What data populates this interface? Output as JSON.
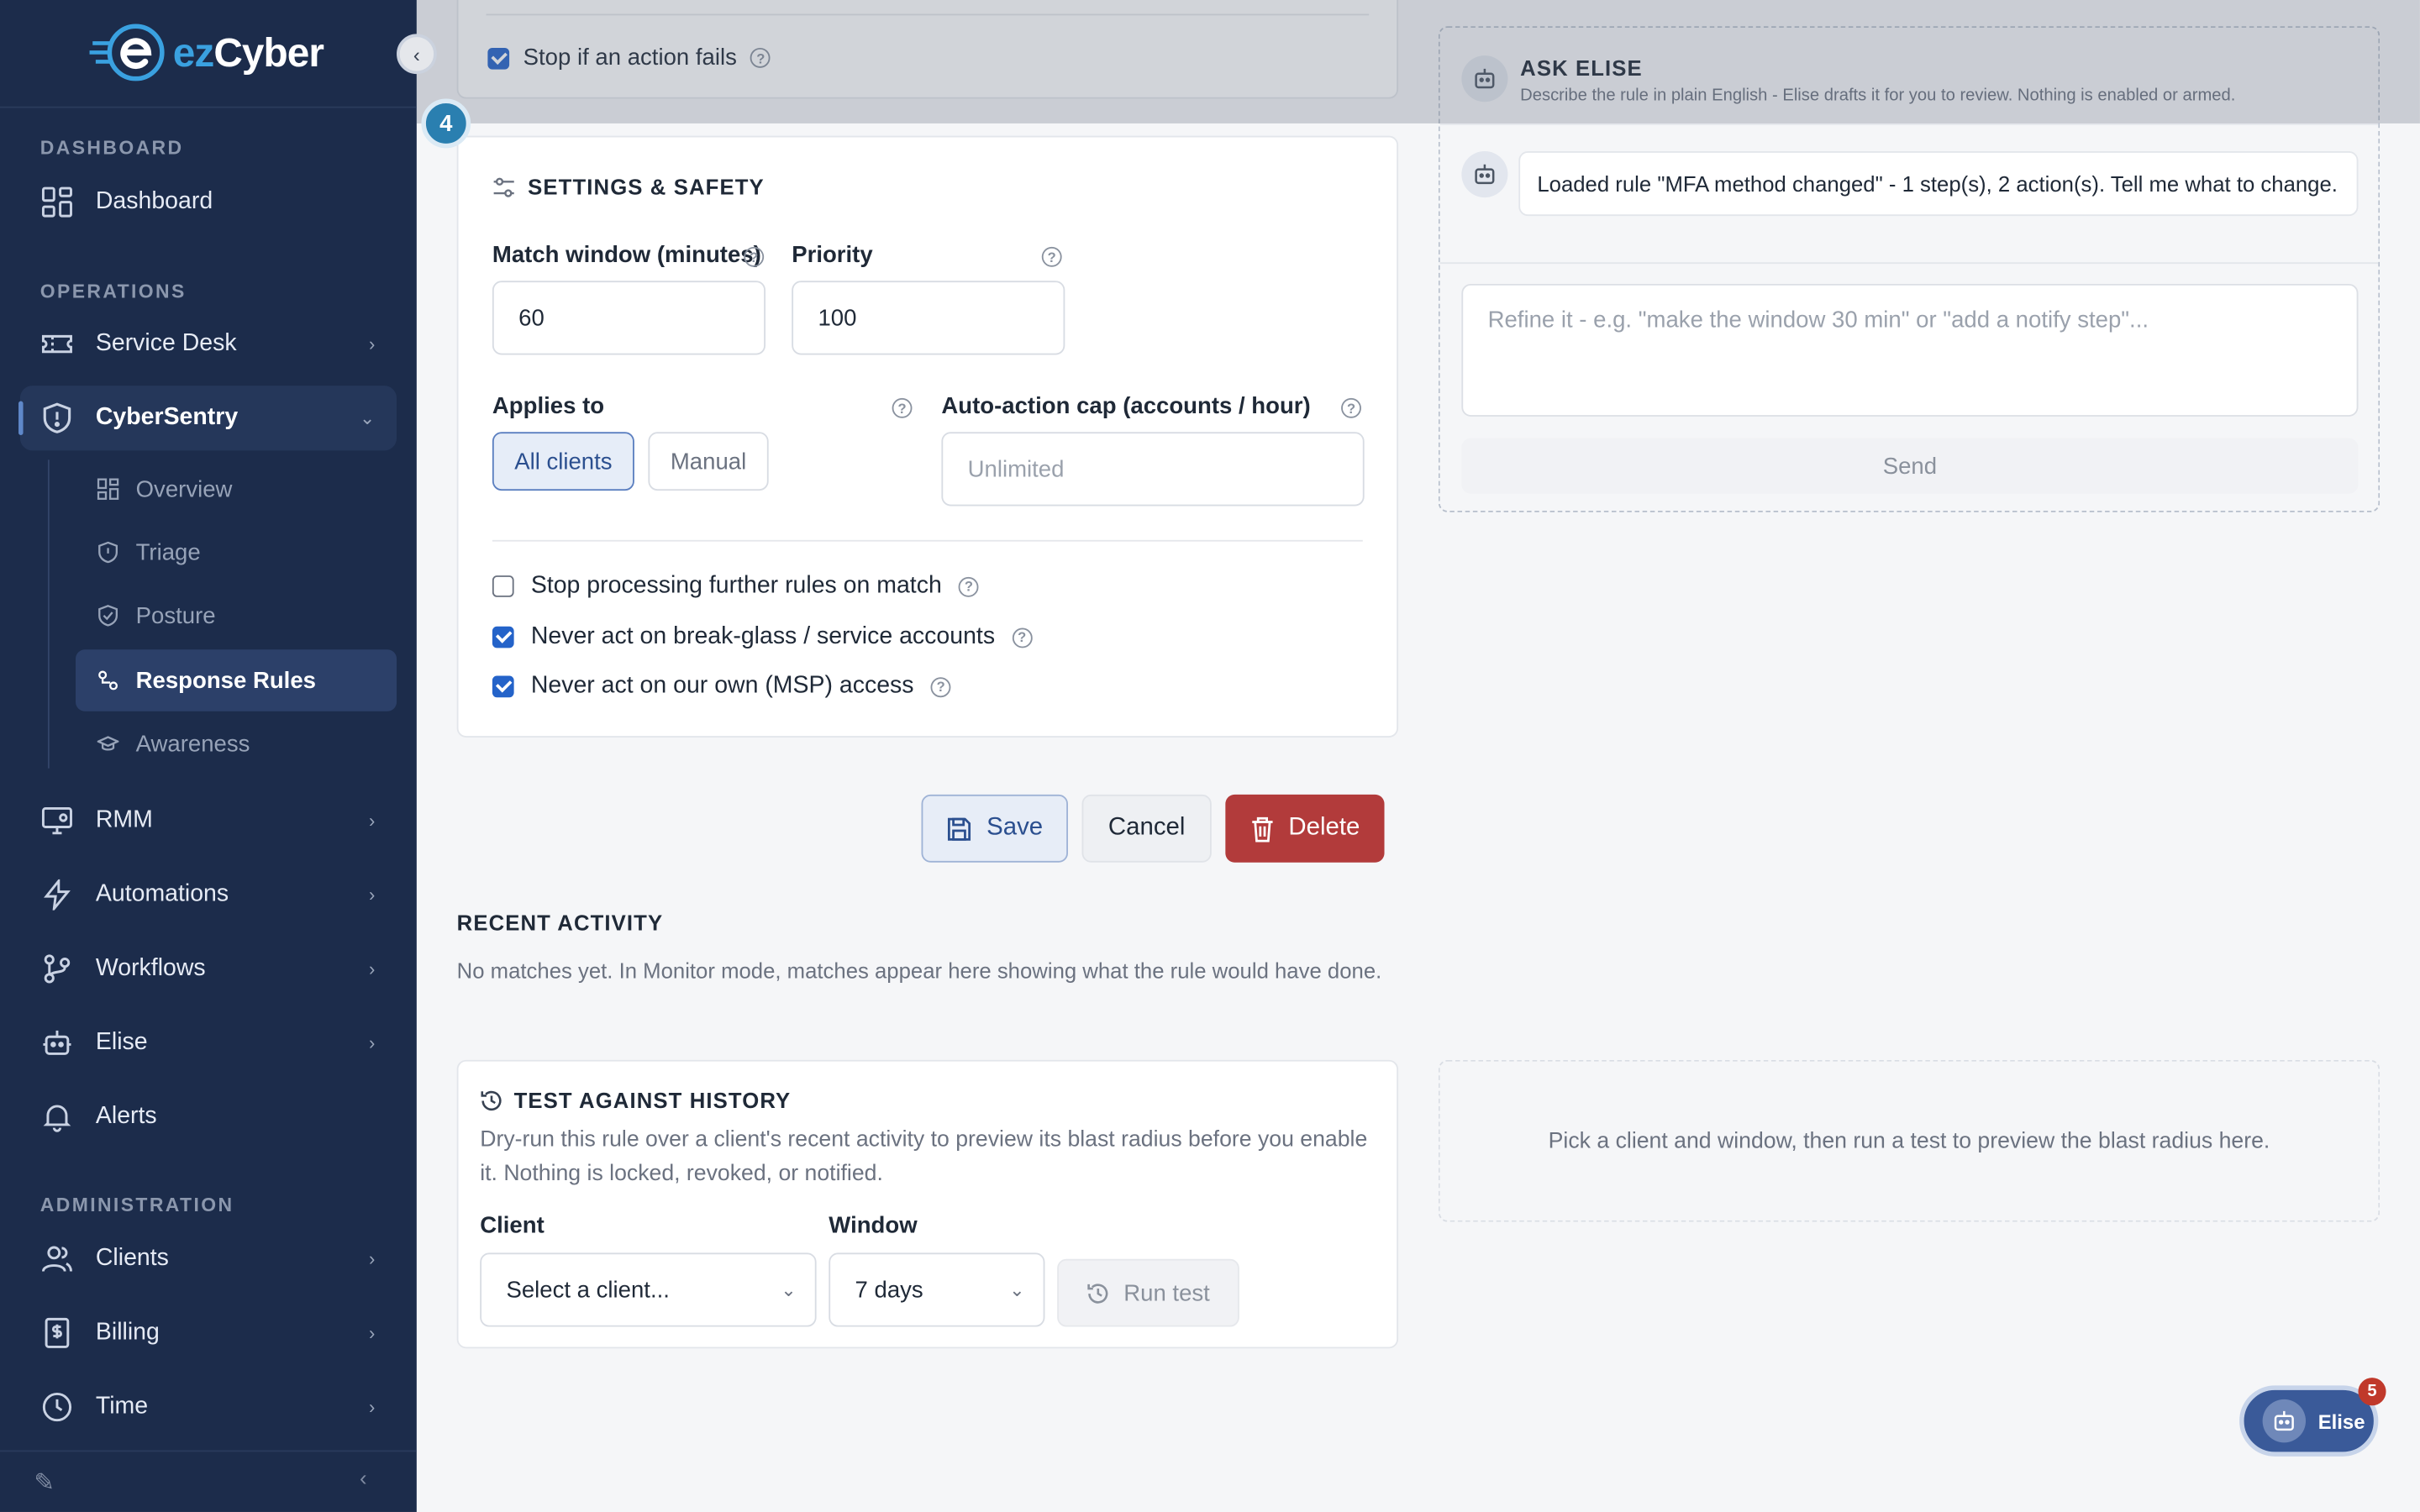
{
  "brand": {
    "logo_prefix": "ez",
    "logo_suffix": "Cyber"
  },
  "sidebar": {
    "sections": {
      "dashboard": "DASHBOARD",
      "operations": "OPERATIONS",
      "administration": "ADMINISTRATION"
    },
    "items": {
      "dashboard": "Dashboard",
      "service_desk": "Service Desk",
      "cybersentry": "CyberSentry",
      "rmm": "RMM",
      "automations": "Automations",
      "workflows": "Workflows",
      "elise": "Elise",
      "alerts": "Alerts",
      "clients": "Clients",
      "billing": "Billing",
      "time": "Time"
    },
    "subitems": {
      "overview": "Overview",
      "triage": "Triage",
      "posture": "Posture",
      "response_rules": "Response Rules",
      "awareness": "Awareness"
    }
  },
  "top_card": {
    "stop_if_fails": "Stop if an action fails",
    "stop_if_fails_checked": true
  },
  "step_number": "4",
  "settings": {
    "title": "SETTINGS & SAFETY",
    "match_window_label": "Match window (minutes)",
    "match_window_value": "60",
    "priority_label": "Priority",
    "priority_value": "100",
    "applies_to_label": "Applies to",
    "applies_all": "All clients",
    "applies_manual": "Manual",
    "cap_label": "Auto-action cap (accounts / hour)",
    "cap_placeholder": "Unlimited",
    "opt_stop_processing": "Stop processing further rules on match",
    "opt_breakglass": "Never act on break-glass / service accounts",
    "opt_msp": "Never act on our own (MSP) access"
  },
  "actions": {
    "save": "Save",
    "cancel": "Cancel",
    "delete": "Delete"
  },
  "recent": {
    "title": "RECENT ACTIVITY",
    "empty": "No matches yet. In Monitor mode, matches appear here showing what the rule would have done."
  },
  "test": {
    "title": "TEST AGAINST HISTORY",
    "description": "Dry-run this rule over a client's recent activity to preview its blast radius before you enable it. Nothing is locked, revoked, or notified.",
    "client_label": "Client",
    "client_value": "Select a client...",
    "window_label": "Window",
    "window_value": "7 days",
    "run": "Run test",
    "preview_hint": "Pick a client and window, then run a test to preview the blast radius here."
  },
  "ask_elise": {
    "title": "ASK ELISE",
    "subtitle": "Describe the rule in plain English - Elise drafts it for you to review. Nothing is enabled or armed.",
    "message": "Loaded rule \"MFA method changed\" - 1 step(s), 2 action(s). Tell me what to change.",
    "input_placeholder": "Refine it - e.g. \"make the window 30 min\" or \"add a notify step\"...",
    "send": "Send"
  },
  "fab": {
    "label": "Elise",
    "badge": "5"
  },
  "colors": {
    "sidebar": "#1c2c4b",
    "accent": "#2463c9",
    "danger": "#b23b3b"
  }
}
